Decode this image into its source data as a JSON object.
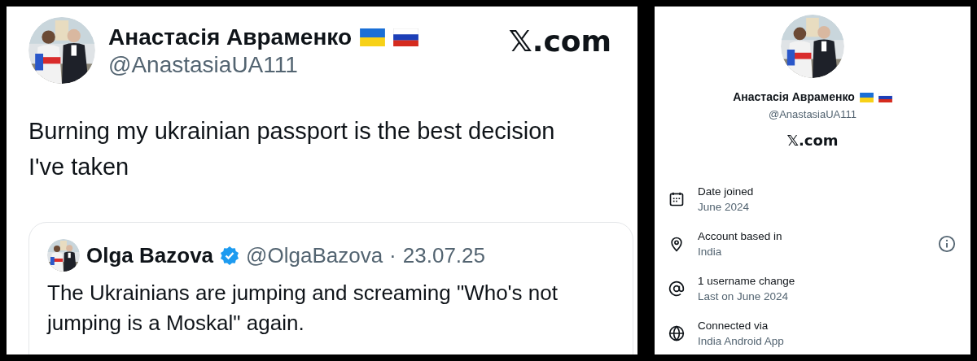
{
  "tweet": {
    "author": "Анастасія Авраменко",
    "handle": "@AnastasiaUA111",
    "site": "𝕏.com",
    "text": "Burning my ukrainian passport is the best decision I've taken",
    "quote": {
      "author": "Olga Bazova",
      "verified": true,
      "handle": "@OlgaBazova",
      "separator": "·",
      "date": "23.07.25",
      "text": "The Ukrainians are jumping and screaming \"Who's not jumping is a Moskal\" again."
    }
  },
  "profile": {
    "author": "Анастасія Авраменко",
    "handle": "@AnastasiaUA111",
    "site": "𝕏.com",
    "details": [
      {
        "kind": "calendar",
        "title": "Date joined",
        "value": "June 2024",
        "info": false
      },
      {
        "kind": "location",
        "title": "Account based in",
        "value": "India",
        "info": true
      },
      {
        "kind": "at",
        "title": "1 username change",
        "value": "Last on June 2024",
        "info": false
      },
      {
        "kind": "globe",
        "title": "Connected via",
        "value": "India Android App",
        "info": false
      }
    ]
  }
}
